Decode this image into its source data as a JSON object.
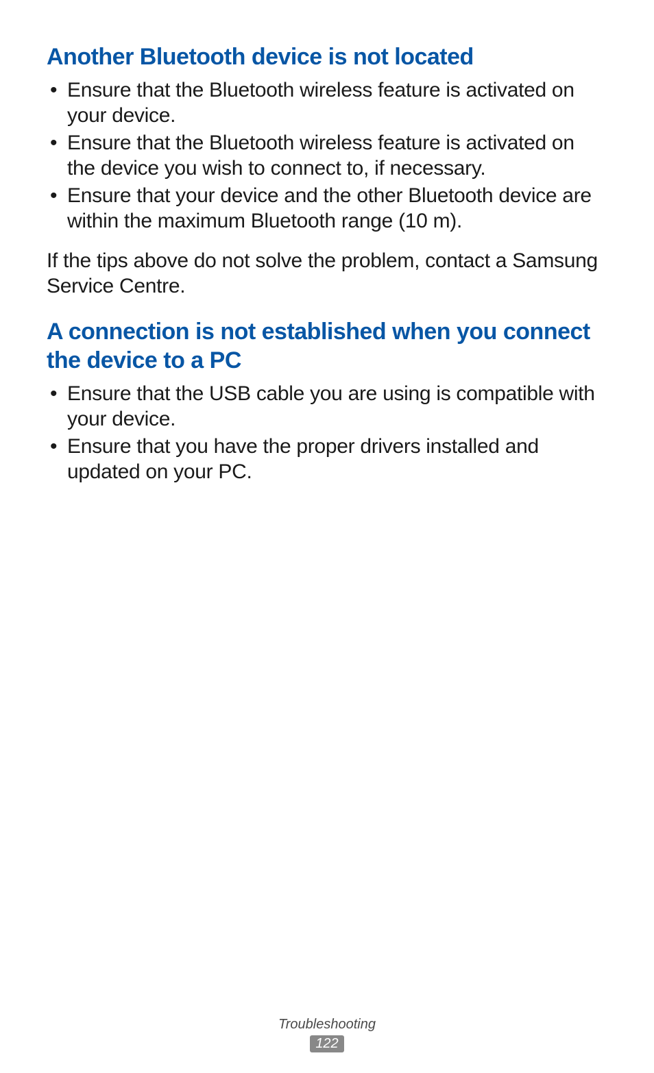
{
  "sections": [
    {
      "heading": "Another Bluetooth device is not located",
      "bullets": [
        "Ensure that the Bluetooth wireless feature is activated on your device.",
        "Ensure that the Bluetooth wireless feature is activated on the device you wish to connect to, if necessary.",
        "Ensure that your device and the other Bluetooth device are within the maximum Bluetooth range (10 m)."
      ],
      "paragraph": "If the tips above do not solve the problem, contact a Samsung Service Centre."
    },
    {
      "heading": "A connection is not established when you connect the device to a PC",
      "bullets": [
        "Ensure that the USB cable you are using is compatible with your device.",
        "Ensure that you have the proper drivers installed and updated on your PC."
      ]
    }
  ],
  "footer": {
    "section_name": "Troubleshooting",
    "page_number": "122"
  }
}
